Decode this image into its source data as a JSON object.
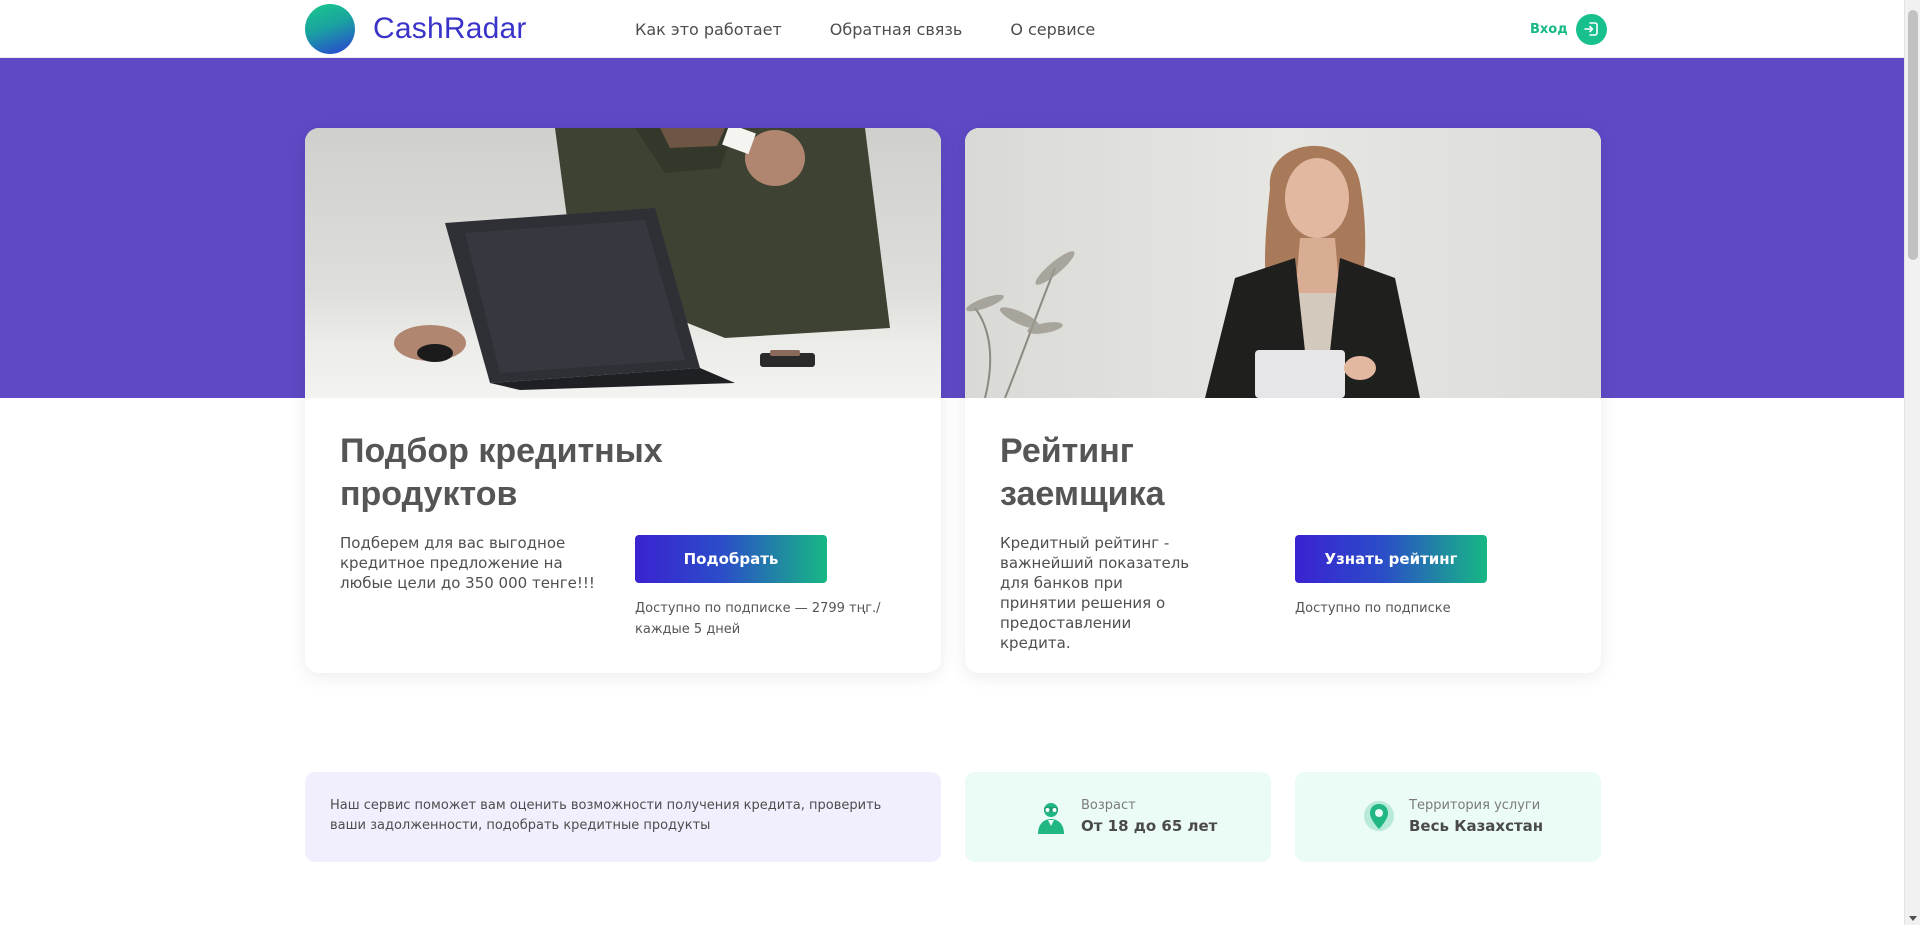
{
  "header": {
    "logo": {
      "part1": "Cash",
      "part2": "Radar"
    },
    "nav": [
      "Как это работает",
      "Обратная связь",
      "О сервисе"
    ],
    "login_label": "Вход"
  },
  "cards": [
    {
      "title_line1": "Подбор кредитных",
      "title_line2": "продуктов",
      "description": "Подберем для вас выгодное кредитное предложение на любые цели до 350 000 тенге!!!",
      "button": "Подобрать",
      "note": "Доступно по подписке — 2799 тңг./ каждые 5 дней"
    },
    {
      "title_line1": "Рейтинг",
      "title_line2": "заемщика",
      "description": "Кредитный рейтинг - важнейший показатель для банков при принятии решения о предоставлении кредита.",
      "button": "Узнать рейтинг",
      "note": "Доступно по подписке"
    }
  ],
  "info": {
    "text": "Наш сервис поможет вам оценить возможности получения кредита, проверить ваши задолженности, подобрать кредитные продукты",
    "age": {
      "label": "Возраст",
      "value": "От 18 до 65 лет"
    },
    "territory": {
      "label": "Территория услуги",
      "value": "Весь Казахстан"
    }
  },
  "colors": {
    "brand": "#3a33c9",
    "hero_purple": "#5f49c5",
    "accent_green": "#18c08e"
  },
  "icons": [
    "login-icon",
    "user-icon",
    "location-pin-icon",
    "chevron-down-icon"
  ]
}
